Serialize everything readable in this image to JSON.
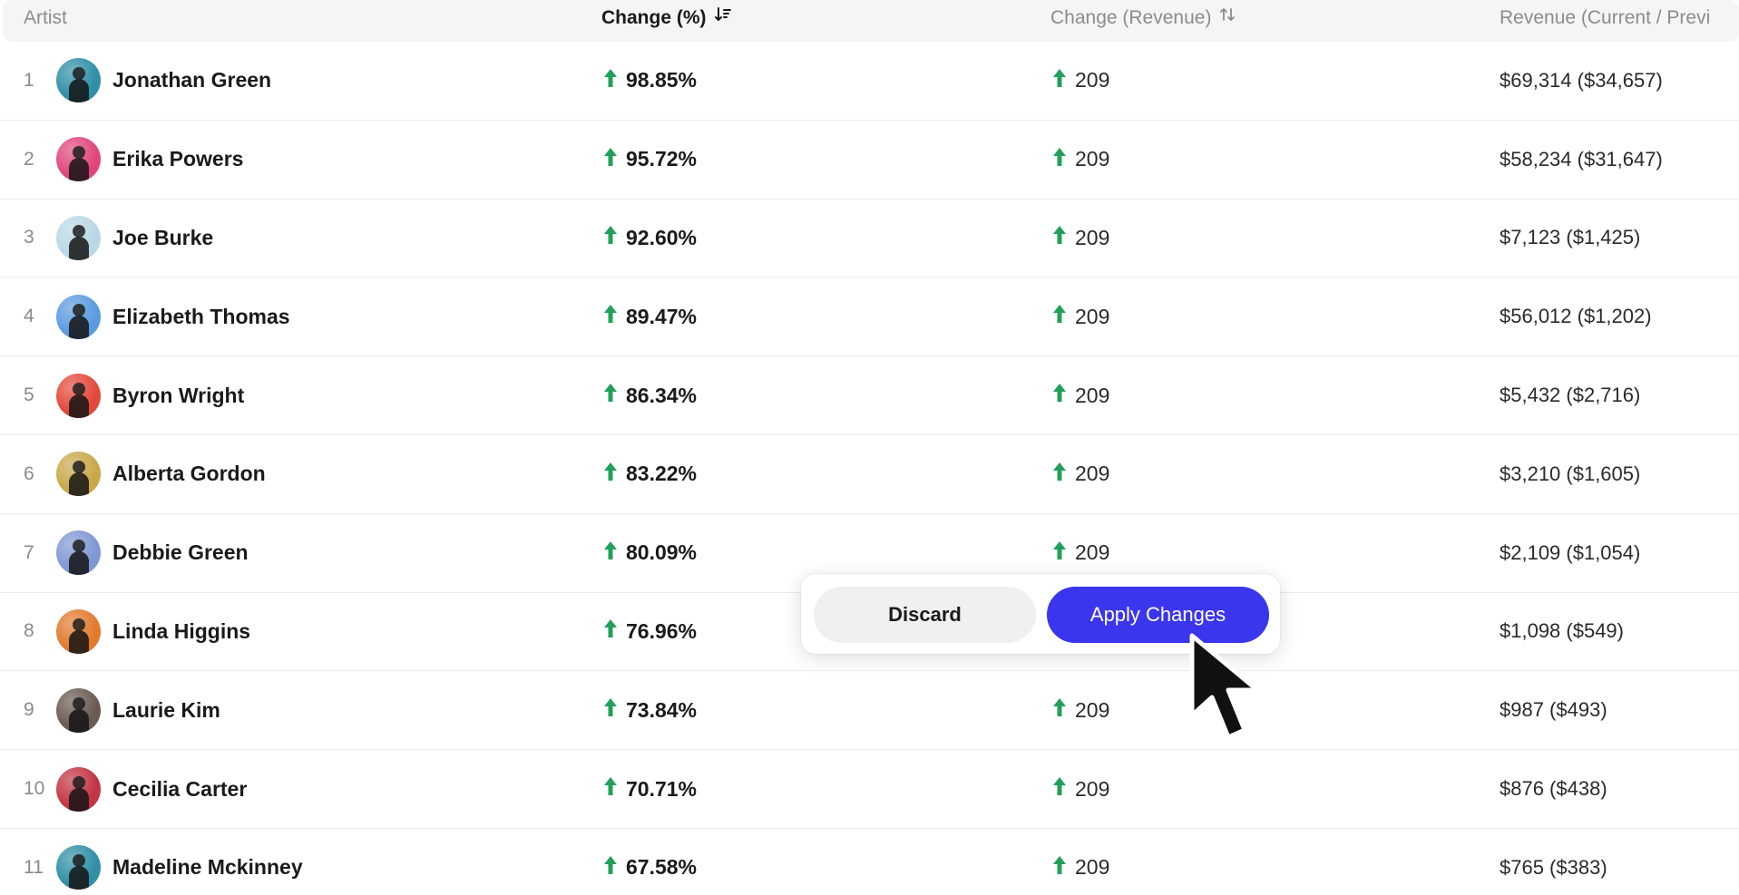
{
  "table": {
    "headers": {
      "artist": "Artist",
      "change_pct": "Change (%)",
      "change_revenue": "Change (Revenue)",
      "revenue": "Revenue (Current / Previ"
    },
    "sorted_by": "change_pct",
    "rows": [
      {
        "rank": "1",
        "name": "Jonathan Green",
        "change_pct": "98.85%",
        "change_revenue": "209",
        "revenue": "$69,314 ($34,657)",
        "avatar_color": "#2f8fa7"
      },
      {
        "rank": "2",
        "name": "Erika Powers",
        "change_pct": "95.72%",
        "change_revenue": "209",
        "revenue": "$58,234 ($31,647)",
        "avatar_color": "#e0467c"
      },
      {
        "rank": "3",
        "name": "Joe Burke",
        "change_pct": "92.60%",
        "change_revenue": "209",
        "revenue": "$7,123 ($1,425)",
        "avatar_color": "#b9d8e6"
      },
      {
        "rank": "4",
        "name": "Elizabeth Thomas",
        "change_pct": "89.47%",
        "change_revenue": "209",
        "revenue": "$56,012 ($1,202)",
        "avatar_color": "#5a9be0"
      },
      {
        "rank": "5",
        "name": "Byron Wright",
        "change_pct": "86.34%",
        "change_revenue": "209",
        "revenue": "$5,432 ($2,716)",
        "avatar_color": "#e2493a"
      },
      {
        "rank": "6",
        "name": "Alberta Gordon",
        "change_pct": "83.22%",
        "change_revenue": "209",
        "revenue": "$3,210 ($1,605)",
        "avatar_color": "#c9a84a"
      },
      {
        "rank": "7",
        "name": "Debbie Green",
        "change_pct": "80.09%",
        "change_revenue": "209",
        "revenue": "$2,109 ($1,054)",
        "avatar_color": "#7f97d4"
      },
      {
        "rank": "8",
        "name": "Linda Higgins",
        "change_pct": "76.96%",
        "change_revenue": "",
        "revenue": "$1,098 ($549)",
        "avatar_color": "#e27a2e"
      },
      {
        "rank": "9",
        "name": "Laurie Kim",
        "change_pct": "73.84%",
        "change_revenue": "209",
        "revenue": "$987 ($493)",
        "avatar_color": "#6a5a52"
      },
      {
        "rank": "10",
        "name": "Cecilia Carter",
        "change_pct": "70.71%",
        "change_revenue": "209",
        "revenue": "$876 ($438)",
        "avatar_color": "#c23444"
      },
      {
        "rank": "11",
        "name": "Madeline Mckinney",
        "change_pct": "67.58%",
        "change_revenue": "209",
        "revenue": "$765 ($383)",
        "avatar_color": "#2f8fa7"
      }
    ]
  },
  "popover": {
    "discard_label": "Discard",
    "apply_label": "Apply Changes"
  },
  "colors": {
    "accent": "#3b35ee",
    "up_green": "#22a05a",
    "header_bg": "#f5f5f6",
    "muted_text": "#8c8c8c"
  },
  "icons": {
    "sort_active": "sort-descending-icon",
    "sort_inactive": "sort-both-icon",
    "trend": "arrow-up-icon",
    "cursor": "mouse-pointer-icon"
  }
}
